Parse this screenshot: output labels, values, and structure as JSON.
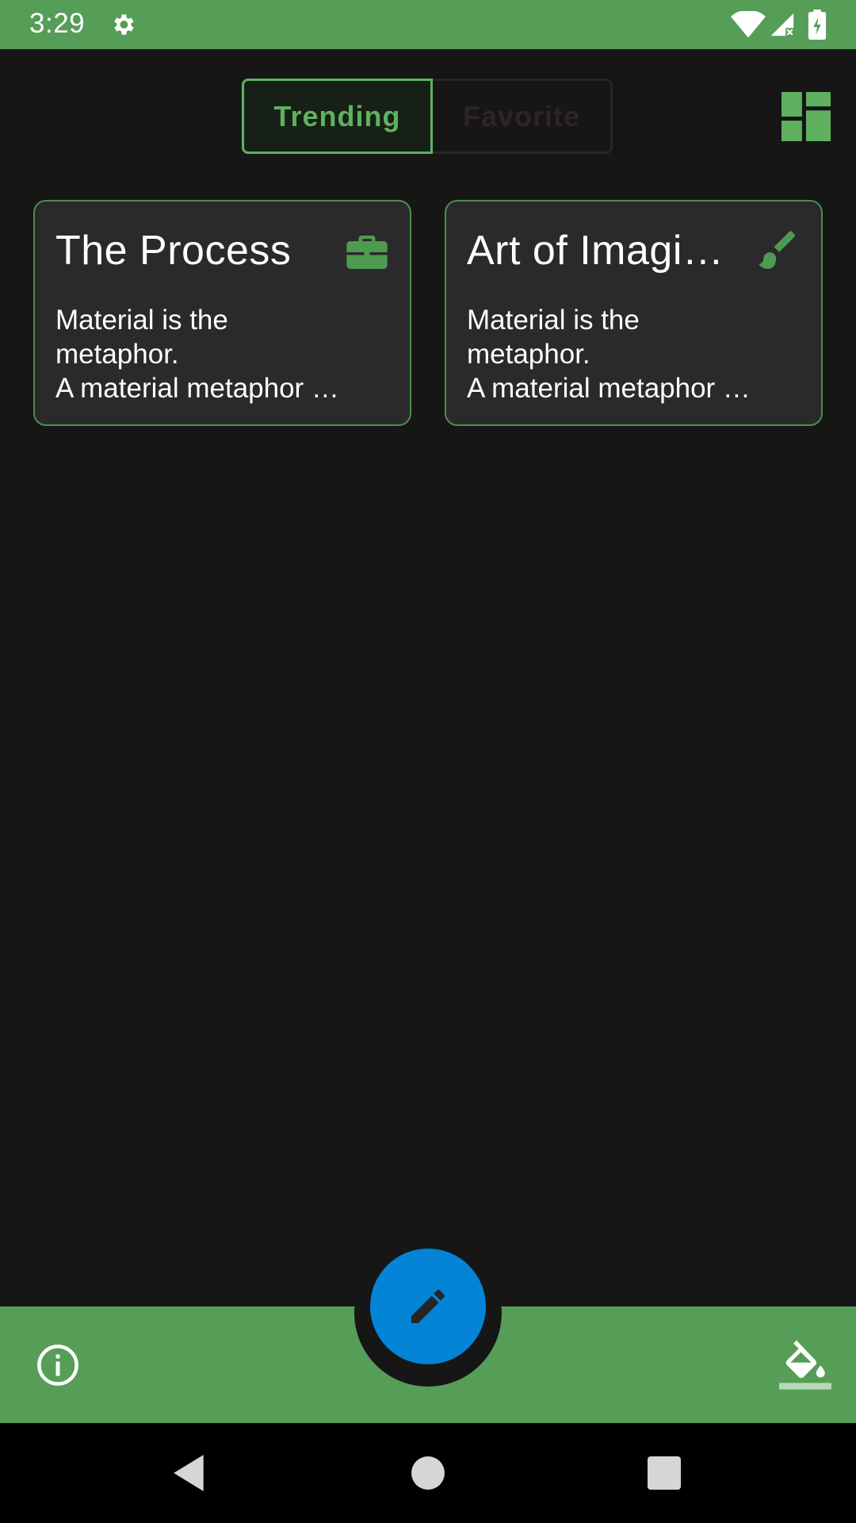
{
  "status_bar": {
    "time": "3:29",
    "icons": [
      "gear-icon",
      "wifi-icon",
      "signal-icon",
      "battery-icon"
    ],
    "background": "#569d57"
  },
  "tabs": [
    {
      "label": "Trending",
      "selected": true
    },
    {
      "label": "Favorite",
      "selected": false
    }
  ],
  "cards": [
    {
      "title": "The Process",
      "text": "Material is the\nmetaphor.\n A material metaphor …",
      "icon": "briefcase-icon"
    },
    {
      "title": "Art of Imagi…",
      "text": "Material is the\nmetaphor.\n A material metaphor …",
      "icon": "brush-icon"
    }
  ],
  "bottom_bar": {
    "left_icon": "info-icon",
    "right_icon": "paint-bucket-icon",
    "fab_icon": "pencil-icon"
  },
  "colors": {
    "accent": "#5fb160",
    "bar": "#569d57",
    "fab": "#0384d6",
    "background": "#161616",
    "card": "#2a292b"
  }
}
